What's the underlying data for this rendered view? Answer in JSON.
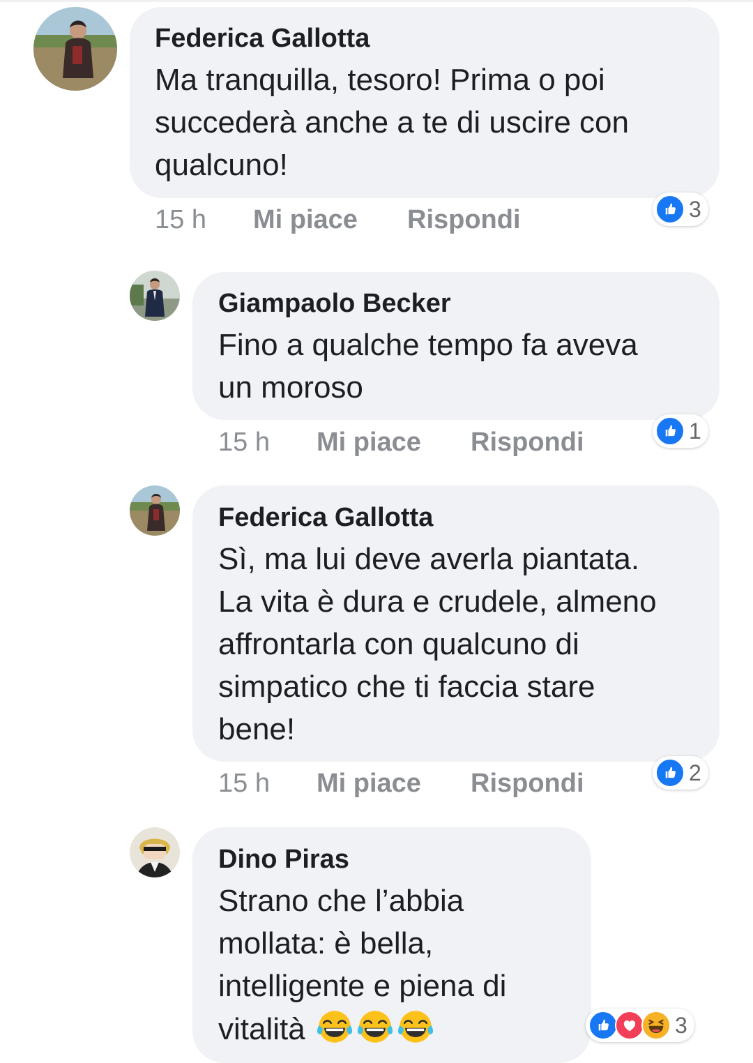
{
  "comments": [
    {
      "author": "Federica Gallotta",
      "lines": [
        "Ma tranquilla, tesoro! Prima o poi",
        "succederà anche a te di uscire con",
        "qualcuno!"
      ],
      "time": "15 h",
      "like_label": "Mi piace",
      "reply_label": "Rispondi",
      "reaction_count": "3",
      "reactions": [
        "like-icon"
      ]
    },
    {
      "author": "Giampaolo Becker",
      "lines": [
        "Fino a qualche tempo fa aveva",
        "un moroso"
      ],
      "time": "15 h",
      "like_label": "Mi piace",
      "reply_label": "Rispondi",
      "reaction_count": "1",
      "reactions": [
        "like-icon"
      ]
    },
    {
      "author": "Federica Gallotta",
      "lines": [
        "Sì, ma lui deve averla piantata.",
        "La vita è dura e crudele, almeno",
        "affrontarla con qualcuno di",
        "simpatico che ti faccia stare",
        "bene!"
      ],
      "time": "15 h",
      "like_label": "Mi piace",
      "reply_label": "Rispondi",
      "reaction_count": "2",
      "reactions": [
        "like-icon"
      ]
    },
    {
      "author": "Dino Piras",
      "lines": [
        "Strano che l’abbia",
        "mollata: è bella,",
        "intelligente e piena di",
        "vitalità"
      ],
      "emoji_after_last_line": [
        "tears-of-joy-emoji",
        "tears-of-joy-emoji",
        "tears-of-joy-emoji"
      ],
      "reaction_count": "3",
      "reactions": [
        "like-icon",
        "love-icon",
        "haha-icon"
      ]
    }
  ],
  "colors": {
    "bubble": "#f0f2f5",
    "like_blue": "#1877f2",
    "love_red": "#f33e58",
    "haha_yellow": "#f7b125",
    "meta_gray": "#8a8d91"
  }
}
